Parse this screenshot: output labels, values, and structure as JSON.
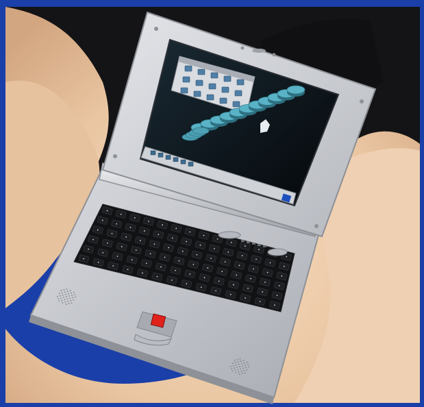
{
  "photo": {
    "frame_color": "#1b3fa8",
    "backdrop_color": "#1a1a1c",
    "cloth_color": "#f1cfae",
    "laptop_body_color": "#c9cbd0",
    "screen_bg_color": "#0e1116",
    "desktop_window_color": "#d9dce0",
    "ribbon_color": "#59b2c6",
    "trackpoint_color": "#e0221b"
  },
  "icons": {
    "window_icons": "app-icon",
    "taskbar_icons": "taskbar-icon",
    "trackpoint": "trackpoint-icon",
    "speaker": "speaker-grille-icon"
  }
}
